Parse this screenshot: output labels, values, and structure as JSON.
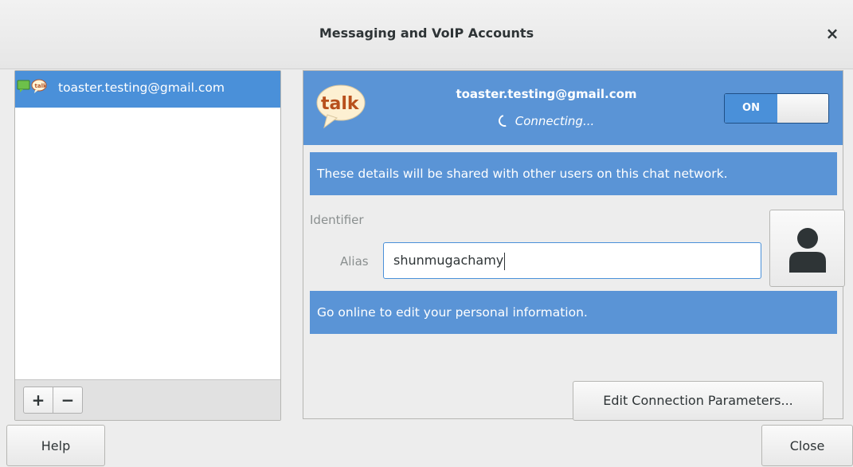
{
  "window": {
    "title": "Messaging and VoIP Accounts",
    "close_glyph": "×"
  },
  "accounts": [
    {
      "label": "toaster.testing@gmail.com",
      "icons": [
        "chat-bubble-icon",
        "talk-icon"
      ],
      "selected": true
    }
  ],
  "list_toolbar": {
    "add_label": "+",
    "remove_label": "−"
  },
  "account_header": {
    "logo_text": "talk",
    "email": "toaster.testing@gmail.com",
    "status": "Connecting...",
    "switch_label": "ON",
    "enabled": true
  },
  "details": {
    "shared_notice": "These details will be shared with other users on this chat network.",
    "identifier_label": "Identifier",
    "alias_label": "Alias",
    "alias_value": "shunmugachamy",
    "offline_notice": "Go online to edit your personal information.",
    "avatar_icon": "user-avatar-icon"
  },
  "buttons": {
    "edit_connection": "Edit Connection Parameters...",
    "help": "Help",
    "close": "Close"
  },
  "colors": {
    "accent": "#4a90d9",
    "header_bg": "#5a94d6",
    "window_bg": "#ededed"
  }
}
